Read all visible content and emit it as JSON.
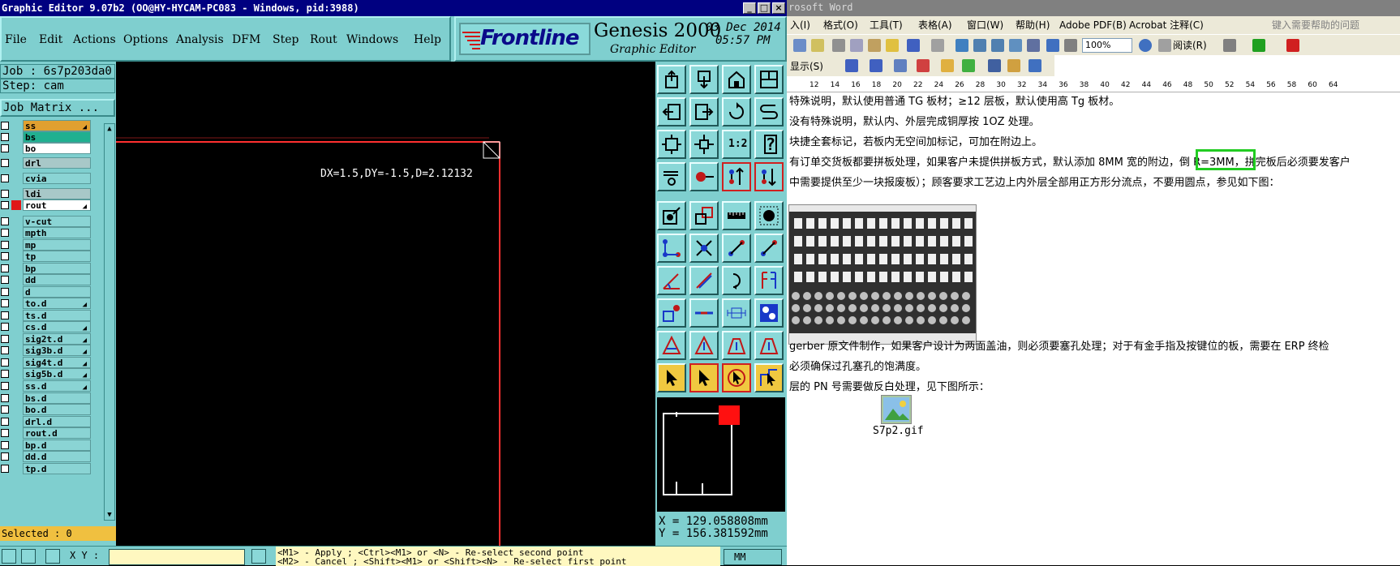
{
  "genesis": {
    "title": "Graphic Editor 9.07b2 (OO@HY-HYCAM-PC083 - Windows, pid:3988)",
    "title_buttons": [
      "_",
      "□",
      "×"
    ],
    "menu": [
      "File",
      "Edit",
      "Actions",
      "Options",
      "Analysis",
      "DFM",
      "Step",
      "Rout",
      "Windows",
      "Help"
    ],
    "brand_logo": "Frontline",
    "brand_name": "Genesis 2000",
    "brand_sub": "Graphic Editor",
    "date": "03 Dec 2014",
    "time": "05:57 PM",
    "job": "Job : 6s7p203da0",
    "step": "Step: cam",
    "job_matrix": "Job Matrix ...",
    "layers": [
      {
        "name": "ss",
        "style": "sel-ss",
        "arrow": "true"
      },
      {
        "name": "bs",
        "style": "sel-bs",
        "arrow": ""
      },
      {
        "name": "bo",
        "style": "white",
        "arrow": ""
      },
      {
        "name": "drl",
        "style": "gray",
        "arrow": ""
      },
      {
        "name": "cvia",
        "style": "",
        "arrow": ""
      },
      {
        "name": "ldi",
        "style": "gray",
        "arrow": ""
      },
      {
        "name": "rout",
        "style": "white",
        "arrow": "true"
      },
      {
        "name": "v-cut",
        "style": "",
        "arrow": ""
      },
      {
        "name": "mpth",
        "style": "",
        "arrow": ""
      },
      {
        "name": "mp",
        "style": "",
        "arrow": ""
      },
      {
        "name": "tp",
        "style": "",
        "arrow": ""
      },
      {
        "name": "bp",
        "style": "",
        "arrow": ""
      },
      {
        "name": "dd",
        "style": "",
        "arrow": ""
      },
      {
        "name": "d",
        "style": "",
        "arrow": ""
      },
      {
        "name": "to.d",
        "style": "",
        "arrow": "true"
      },
      {
        "name": "ts.d",
        "style": "",
        "arrow": ""
      },
      {
        "name": "cs.d",
        "style": "",
        "arrow": "true"
      },
      {
        "name": "sig2t.d",
        "style": "",
        "arrow": "true"
      },
      {
        "name": "sig3b.d",
        "style": "",
        "arrow": "true"
      },
      {
        "name": "sig4t.d",
        "style": "",
        "arrow": "true"
      },
      {
        "name": "sig5b.d",
        "style": "",
        "arrow": "true"
      },
      {
        "name": "ss.d",
        "style": "",
        "arrow": "true"
      },
      {
        "name": "bs.d",
        "style": "",
        "arrow": ""
      },
      {
        "name": "bo.d",
        "style": "",
        "arrow": ""
      },
      {
        "name": "drl.d",
        "style": "",
        "arrow": ""
      },
      {
        "name": "rout.d",
        "style": "",
        "arrow": ""
      },
      {
        "name": "bp.d",
        "style": "",
        "arrow": ""
      },
      {
        "name": "dd.d",
        "style": "",
        "arrow": ""
      },
      {
        "name": "tp.d",
        "style": "",
        "arrow": ""
      }
    ],
    "selected": "Selected : 0",
    "measure": "DX=1.5,DY=-1.5,D=2.12132",
    "tool_labels": {
      "ratio": "1:2",
      "help": "?"
    },
    "coord_x": "X = 129.058808mm",
    "coord_y": "Y = 156.381592mm",
    "xy_label": "X Y :",
    "message_line1": "<M1> - Apply ; <Ctrl><M1> or <N> - Re-select second point",
    "message_line2": "<M2> - Cancel ; <Shift><M1> or <Shift><N> - Re-select first point",
    "units": "MM"
  },
  "word": {
    "title": "rosoft Word",
    "menu": [
      "入(I)",
      "格式(O)",
      "工具(T)",
      "表格(A)",
      "窗口(W)",
      "帮助(H)",
      "Adobe PDF(B)",
      "Acrobat 注释(C)"
    ],
    "help_placeholder": "键入需要帮助的问题",
    "zoom": "100%",
    "read_label": "阅读(R)",
    "display_label": "显示(S)",
    "ruler_ticks": [
      "12",
      "14",
      "16",
      "18",
      "20",
      "22",
      "24",
      "26",
      "28",
      "30",
      "32",
      "34",
      "36",
      "38",
      "40",
      "42",
      "44",
      "46",
      "48",
      "50",
      "52",
      "54",
      "56",
      "58",
      "60",
      "64"
    ],
    "paragraphs": [
      "特殊说明，默认使用普通 TG 板材；≥12 层板，默认使用高 Tg 板材。",
      "没有特殊说明，默认内、外层完成铜厚按 1OZ 处理。",
      "块捷全套标记，若板内无空间加标记，可加在附边上。",
      "有订单交货板都要拼板处理，如果客户未提供拼板方式，默认添加 8MM 宽的附边，倒 R=3MM，拼完板后必须要发客户",
      "中需要提供至少一块报废板）；顾客要求工艺边上内外层全部用正方形分流点，不要用圆点，参见如下图：",
      "gerber 原文件制作，如果客户设计为两面盖油，则必须要塞孔处理；对于有金手指及按键位的板，需要在 ERP 终检",
      "必须确保过孔塞孔的饱满度。",
      "层的 PN 号需要做反白处理，见下图所示："
    ],
    "gif_caption": "S7p2.gif",
    "highlight_color": "#22cc22"
  }
}
